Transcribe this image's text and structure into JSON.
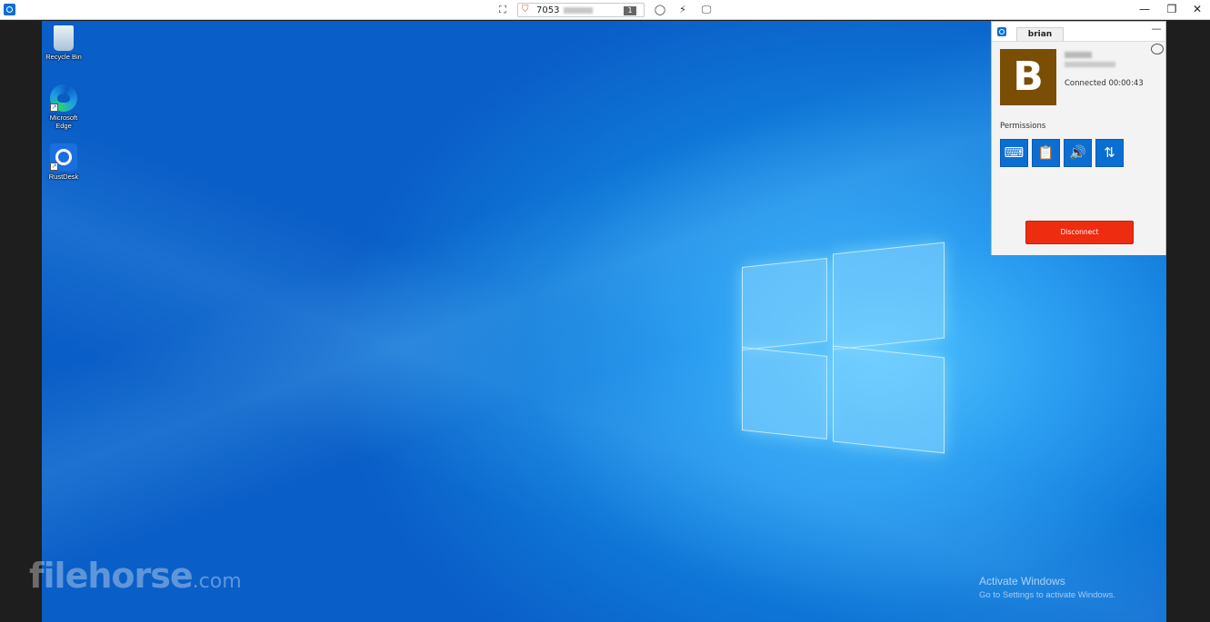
{
  "toolbar": {
    "remote_id": "7053",
    "display_number": "1",
    "icons": [
      "fullscreen-icon",
      "shield-icon",
      "chat-icon",
      "action-icon",
      "display-icon"
    ]
  },
  "window_controls": {
    "minimize": "—",
    "restore": "❐",
    "close": "✕"
  },
  "desktop": {
    "icons": [
      {
        "label": "Recycle Bin",
        "icon": "recycle-bin-icon"
      },
      {
        "label": "Microsoft Edge",
        "icon": "edge-icon"
      },
      {
        "label": "RustDesk",
        "icon": "rustdesk-icon"
      }
    ],
    "activation_title": "Activate Windows",
    "activation_subtitle": "Go to Settings to activate Windows."
  },
  "watermark": {
    "brand": "filehorse",
    "suffix": ".com"
  },
  "connection_manager": {
    "tab_label": "brian",
    "minimize": "—",
    "avatar_letter": "B",
    "avatar_color": "#7a4e05",
    "status": "Connected 00:00:43",
    "permissions_label": "Permissions",
    "permissions": [
      {
        "name": "keyboard",
        "icon": "keyboard-icon",
        "glyph": "⌨"
      },
      {
        "name": "clipboard",
        "icon": "clipboard-icon",
        "glyph": "📋"
      },
      {
        "name": "audio",
        "icon": "speaker-icon",
        "glyph": "🔊"
      },
      {
        "name": "file-transfer",
        "icon": "file-transfer-icon",
        "glyph": "⇅"
      }
    ],
    "disconnect_label": "Disconnect",
    "disconnect_color": "#ee2c10"
  }
}
